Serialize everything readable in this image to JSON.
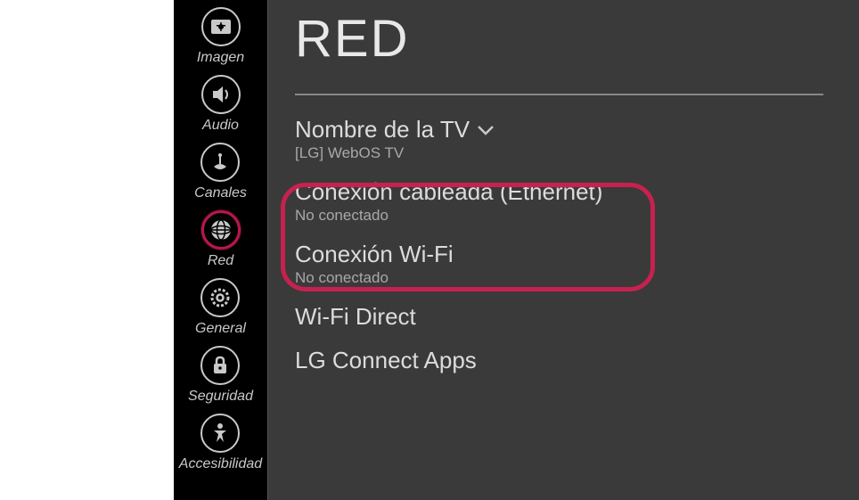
{
  "sidebar": {
    "items": [
      {
        "label": "Imagen"
      },
      {
        "label": "Audio"
      },
      {
        "label": "Canales"
      },
      {
        "label": "Red"
      },
      {
        "label": "General"
      },
      {
        "label": "Seguridad"
      },
      {
        "label": "Accesibilidad"
      }
    ]
  },
  "main": {
    "title": "RED",
    "options": [
      {
        "title": "Nombre de la TV",
        "sub": "[LG] WebOS TV",
        "chevron": true
      },
      {
        "title": "Conexión cableada (Ethernet)",
        "sub": "No conectado"
      },
      {
        "title": "Conexión Wi-Fi",
        "sub": "No conectado"
      },
      {
        "title": "Wi-Fi Direct"
      },
      {
        "title": "LG Connect Apps"
      }
    ]
  }
}
